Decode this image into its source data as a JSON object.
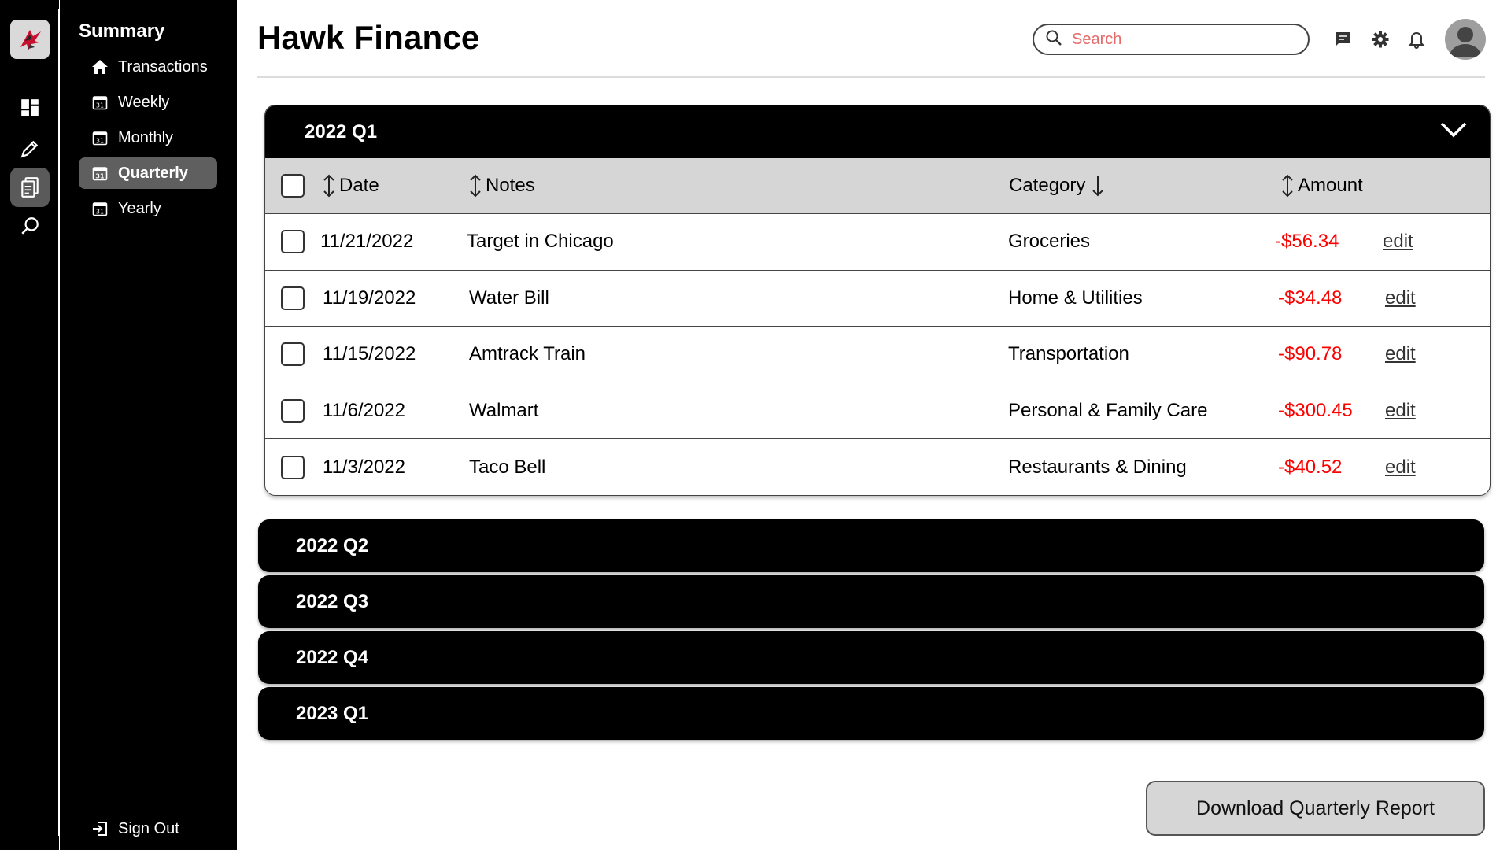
{
  "app": {
    "title": "Hawk Finance"
  },
  "rail": {
    "icons": [
      "hawk-logo",
      "dashboard-icon",
      "pencil-icon",
      "documents-icon",
      "search-chat-icon"
    ]
  },
  "subnav": {
    "heading": "Summary",
    "items": [
      {
        "label": "Transactions",
        "icon": "home-icon",
        "active": false
      },
      {
        "label": "Weekly",
        "icon": "calendar-icon",
        "active": false
      },
      {
        "label": "Monthly",
        "icon": "calendar-icon",
        "active": false
      },
      {
        "label": "Quarterly",
        "icon": "calendar-icon",
        "active": true
      },
      {
        "label": "Yearly",
        "icon": "calendar-icon",
        "active": false
      }
    ],
    "signout": "Sign Out"
  },
  "header": {
    "search_placeholder": "Search",
    "icons": [
      "message-icon",
      "gear-icon",
      "bell-icon",
      "avatar"
    ]
  },
  "quarters": {
    "open": {
      "label": "2022 Q1",
      "columns": {
        "date": "Date",
        "notes": "Notes",
        "category": "Category",
        "amount": "Amount"
      },
      "rows": [
        {
          "date": "11/21/2022",
          "notes": "Target in Chicago",
          "category": "Groceries",
          "amount": "-$56.34",
          "edit": "edit"
        },
        {
          "date": "11/19/2022",
          "notes": "Water Bill",
          "category": "Home & Utilities",
          "amount": "-$34.48",
          "edit": "edit"
        },
        {
          "date": "11/15/2022",
          "notes": "Amtrack Train",
          "category": "Transportation",
          "amount": "-$90.78",
          "edit": "edit"
        },
        {
          "date": "11/6/2022",
          "notes": "Walmart",
          "category": "Personal & Family Care",
          "amount": "-$300.45",
          "edit": "edit"
        },
        {
          "date": "11/3/2022",
          "notes": "Taco Bell",
          "category": "Restaurants & Dining",
          "amount": "-$40.52",
          "edit": "edit"
        }
      ]
    },
    "collapsed": [
      {
        "label": "2022 Q2"
      },
      {
        "label": "2022 Q3"
      },
      {
        "label": "2022 Q4"
      },
      {
        "label": "2023 Q1"
      }
    ]
  },
  "actions": {
    "download_label": "Download Quarterly Report"
  },
  "colors": {
    "accent_red": "#ff0000",
    "active_nav": "#5f5f5f",
    "search_placeholder": "#e66a6a"
  }
}
